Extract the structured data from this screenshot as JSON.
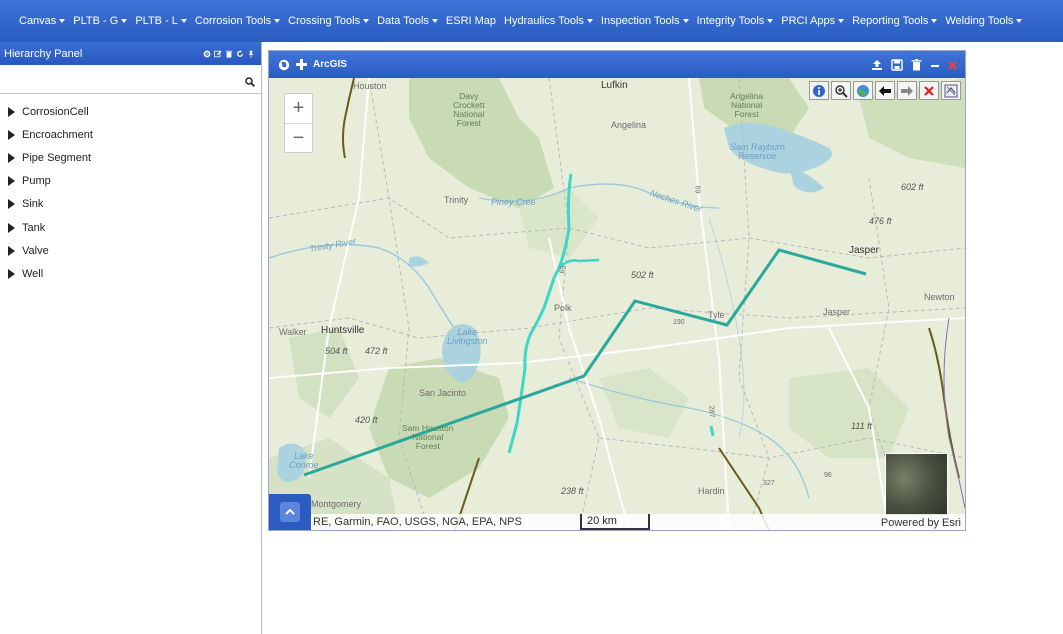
{
  "nav": {
    "items": [
      {
        "label": "Canvas",
        "dropdown": true
      },
      {
        "label": "PLTB - G",
        "dropdown": true
      },
      {
        "label": "PLTB - L",
        "dropdown": true
      },
      {
        "label": "Corrosion Tools",
        "dropdown": true
      },
      {
        "label": "Crossing Tools",
        "dropdown": true
      },
      {
        "label": "Data Tools",
        "dropdown": true
      },
      {
        "label": "ESRI Map",
        "dropdown": false
      },
      {
        "label": "Hydraulics Tools",
        "dropdown": true
      },
      {
        "label": "Inspection Tools",
        "dropdown": true
      },
      {
        "label": "Integrity Tools",
        "dropdown": true
      },
      {
        "label": "PRCI Apps",
        "dropdown": true
      },
      {
        "label": "Reporting Tools",
        "dropdown": true
      },
      {
        "label": "Welding Tools",
        "dropdown": true
      }
    ]
  },
  "hierarchy_panel": {
    "title": "Hierarchy Panel",
    "search_value": "",
    "tree_items": [
      "CorrosionCell",
      "Encroachment",
      "Pipe Segment",
      "Pump",
      "Sink",
      "Tank",
      "Valve",
      "Well"
    ]
  },
  "map_window": {
    "title": "ArcGIS",
    "attribution": "RE, Garmin, FAO, USGS, NGA, EPA, NPS",
    "scale_label": "20 km",
    "powered_by": "Powered by Esri",
    "zoom_in": "+",
    "zoom_out": "−",
    "labels": {
      "houston": "Houston",
      "lufkin": "Lufkin",
      "davy_crockett": "Davy\nCrockett\nNational\nForest",
      "angelina_forest": "Angelina\nNational\nForest",
      "angelina": "Angelina",
      "sam_rayburn": "Sam Rayburn\nReservoir",
      "trinity": "Trinity",
      "piney_creek": "Piney Cree",
      "neches_river": "Neches River",
      "trinity_river": "Trinity River",
      "e602": "602 ft",
      "e476": "476 ft",
      "jasper_city": "Jasper",
      "e502": "502 ft",
      "polk": "Polk",
      "tyler": "Tyle",
      "newton": "Newton",
      "jasper_county": "Jasper",
      "walker": "Walker",
      "huntsville": "Huntsville",
      "e504": "504 ft",
      "e472": "472 ft",
      "lake_livingston": "Lake\nLivingston",
      "san_jacinto": "San Jacinto",
      "e420": "420 ft",
      "sam_houston": "Sam Houston\nNational\nForest",
      "lake_conroe": "Lake\nConroe",
      "e111": "111 ft",
      "e238": "238 ft",
      "hardin": "Hardin",
      "montgomery": "Montgomery",
      "hwy_69": "69",
      "hwy_59": "59",
      "hwy_190": "190",
      "hwy_287": "287",
      "hwy_96": "96",
      "hwy_327": "327"
    }
  },
  "colors": {
    "nav_bg": "#2f62c8",
    "pipeline": "#2aa89b",
    "stream": "#3fd6c6",
    "fault_line": "#6b5a1a"
  }
}
